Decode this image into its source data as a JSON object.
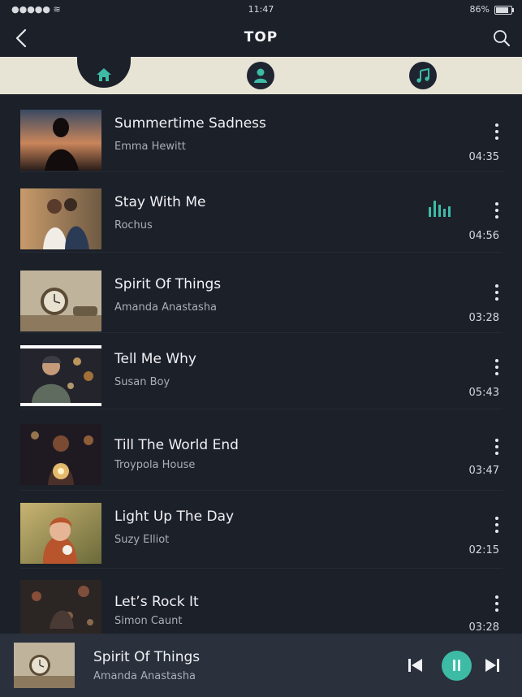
{
  "status": {
    "time": "11:47",
    "battery": "86%"
  },
  "header": {
    "title": "TOP",
    "back_icon": "chevron-left-icon",
    "search_icon": "search-icon"
  },
  "tabs": [
    {
      "icon": "home-icon",
      "active": true
    },
    {
      "icon": "user-icon",
      "active": false
    },
    {
      "icon": "music-note-icon",
      "active": false
    }
  ],
  "songs": [
    {
      "title": "Summertime Sadness",
      "artist": "Emma Hewitt",
      "duration": "04:35"
    },
    {
      "title": "Stay With Me",
      "artist": "Rochus",
      "duration": "04:56",
      "playing_indicator": "equalizer-icon"
    },
    {
      "title": "Spirit Of Things",
      "artist": "Amanda Anastasha",
      "duration": "03:28"
    },
    {
      "title": "Tell Me Why",
      "artist": "Susan Boy",
      "duration": "05:43"
    },
    {
      "title": "Till The World End",
      "artist": "Troypola House",
      "duration": "03:47"
    },
    {
      "title": "Light Up The Day",
      "artist": "Suzy Elliot",
      "duration": "02:15"
    },
    {
      "title": "Let’s Rock It",
      "artist": "Simon Caunt",
      "duration": "03:28"
    }
  ],
  "player": {
    "title": "Spirit Of Things",
    "artist": "Amanda Anastasha"
  },
  "colors": {
    "background": "#1c2029",
    "accent": "#3dbba5",
    "tab_strip": "#e7e4d6",
    "player_bar": "#2a303c"
  }
}
